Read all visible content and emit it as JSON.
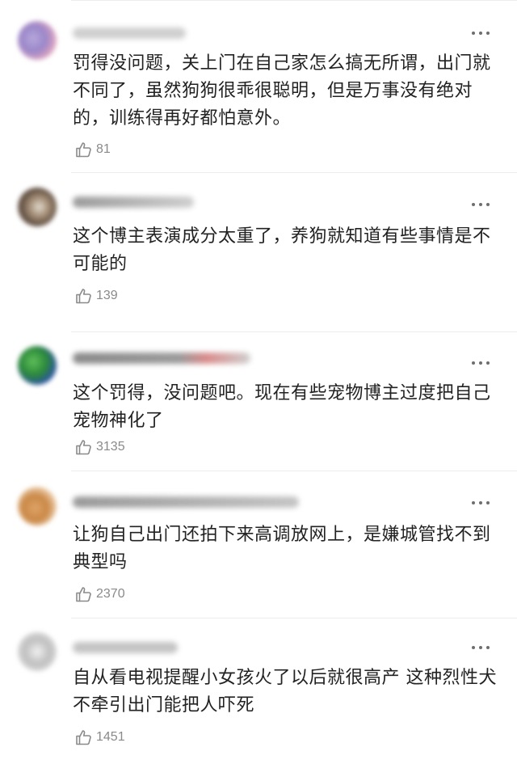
{
  "comments": [
    {
      "username": "用户",
      "text": "罚得没问题，关上门在自己家怎么搞无所谓，出门就不同了，虽然狗狗很乖很聪明，但是万事没有绝对的，训练得再好都怕意外。",
      "likes": "81",
      "avatar_color": "#a99bd0",
      "avatar_color2": "#e8a3b7",
      "name_color": "#c9c9c9"
    },
    {
      "username": "用户",
      "text": "这个博主表演成分太重了，养狗就知道有些事情是不可能的",
      "likes": "139",
      "avatar_color": "#7a6a5a",
      "avatar_color2": "#c8b9a6",
      "name_color": "#9e9e9e"
    },
    {
      "username": "用户",
      "text": "这个罚得，没问题吧。现在有些宠物博主过度把自己宠物神化了",
      "likes": "3135",
      "avatar_color": "#2e7d3a",
      "avatar_color2": "#3a5fb5",
      "name_color": "#8e8e8e"
    },
    {
      "username": "用户",
      "text": "让狗自己出门还拍下来高调放网上，是嫌城管找不到典型吗",
      "likes": "2370",
      "avatar_color": "#d79a5e",
      "avatar_color2": "#f2d3b3",
      "name_color": "#a3a3a3"
    },
    {
      "username": "用户",
      "text": "自从看电视提醒小女孩火了以后就很高产 这种烈性犬不牵引出门能把人吓死",
      "likes": "1451",
      "avatar_color": "#bdbdbd",
      "avatar_color2": "#eeeeee",
      "name_color": "#b8b8b8"
    }
  ],
  "icons": {
    "like": "thumbs-up-icon",
    "more": "more-dots-icon"
  }
}
